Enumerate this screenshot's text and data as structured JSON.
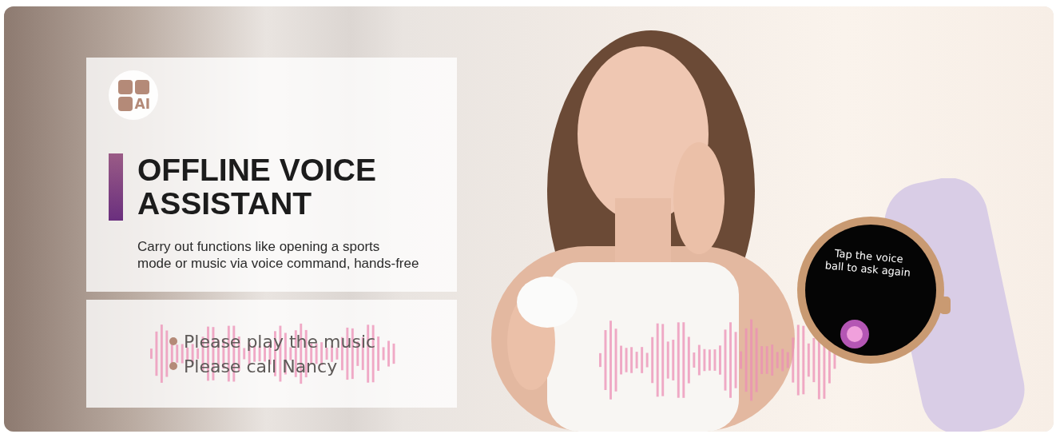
{
  "badge": {
    "label": "AI"
  },
  "heading": {
    "lines": [
      "OFFLINE VOICE",
      "ASSISTANT"
    ]
  },
  "description": {
    "lines": [
      "Carry out functions like opening a sports",
      "mode or music via voice command, hands-free"
    ]
  },
  "commands": [
    "Please play the music",
    "Please call Nancy"
  ],
  "watch": {
    "screen_lines": [
      "Tap the voice",
      "ball to ask again"
    ]
  }
}
